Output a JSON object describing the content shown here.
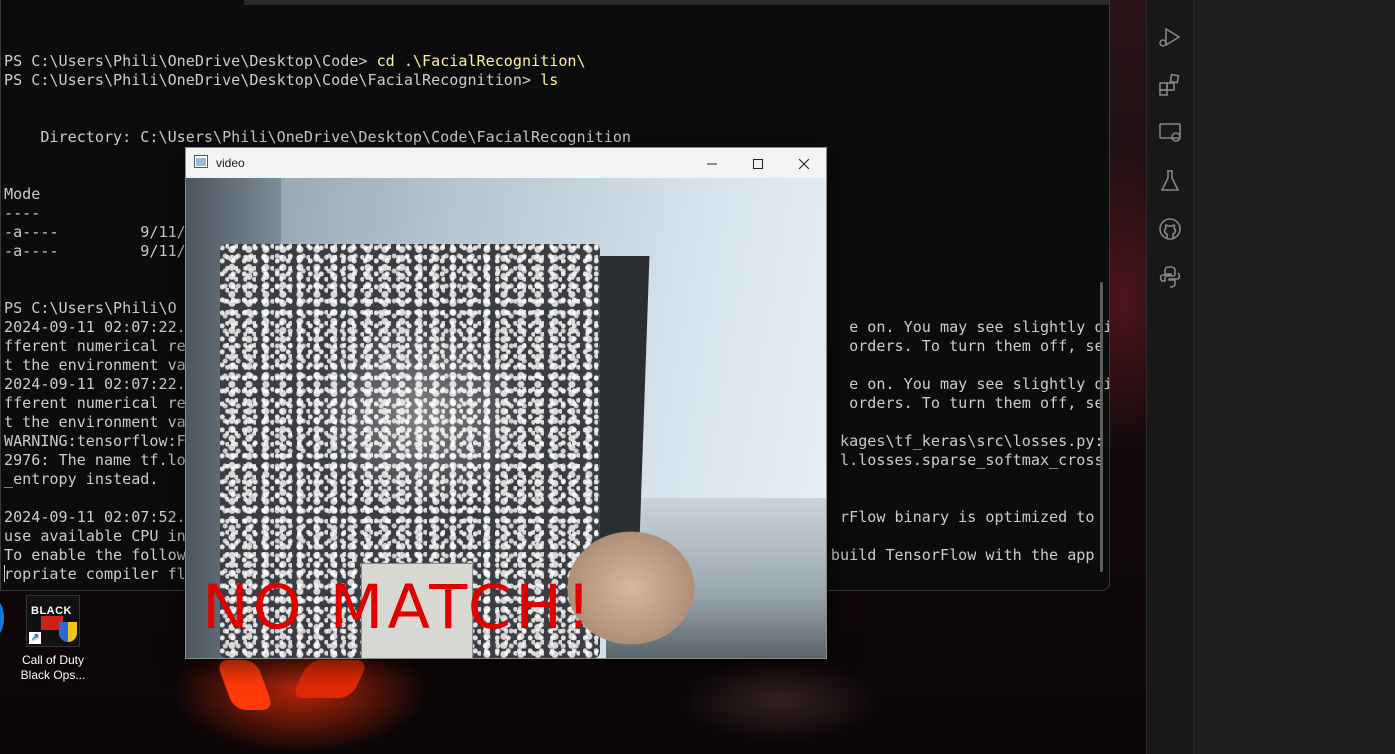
{
  "terminal": {
    "lines": [
      "",
      "PS C:\\Users\\Phili\\OneDrive\\Desktop\\Code> ",
      "PS C:\\Users\\Phili\\OneDrive\\Desktop\\Code\\FacialRecognition> ",
      "",
      "",
      "    Directory: C:\\Users\\Phili\\OneDrive\\Desktop\\Code\\FacialRecognition",
      "",
      "",
      "Mode",
      "----",
      "-a----         9/11/2",
      "-a----         9/11/2",
      "",
      "",
      "PS C:\\Users\\Phili\\O                                                                                  ",
      "2024-09-11 02:07:22.                                                                         e on. You may see slightly di",
      "fferent numerical re                                                                         orders. To turn them off, se",
      "t the environment va                                                                          ",
      "2024-09-11 02:07:22.                                                                         e on. You may see slightly di",
      "fferent numerical re                                                                         orders. To turn them off, se",
      "t the environment va                                                                          ",
      "WARNING:tensorflow:F                                                                        kages\\tf_keras\\src\\losses.py:",
      "2976: The name tf.lo                                                                        l.losses.sparse_softmax_cross",
      "_entropy instead.",
      "",
      "2024-09-11 02:07:52.                                                                        rFlow binary is optimized to",
      "use available CPU in",
      "To enable the follow                                                                       build TensorFlow with the app",
      "ropriate compiler fl"
    ],
    "commands": {
      "line1": "cd .\\FacialRecognition\\",
      "line2": "ls"
    }
  },
  "desktop_icons": [
    {
      "label_line1": "Call of Duty",
      "label_line2": "Black Ops..."
    }
  ],
  "video_window": {
    "title": "video",
    "overlay_text": "NO MATCH!"
  },
  "icons": {
    "activity": [
      "run-debug-icon",
      "extensions-icon",
      "remote-explorer-icon",
      "testing-icon",
      "github-icon",
      "python-icon"
    ]
  },
  "colors": {
    "terminal_bg": "#0c0c0c",
    "terminal_fg": "#cccccc",
    "command": "#f9f1a5",
    "overlay_text": "#e00000"
  }
}
